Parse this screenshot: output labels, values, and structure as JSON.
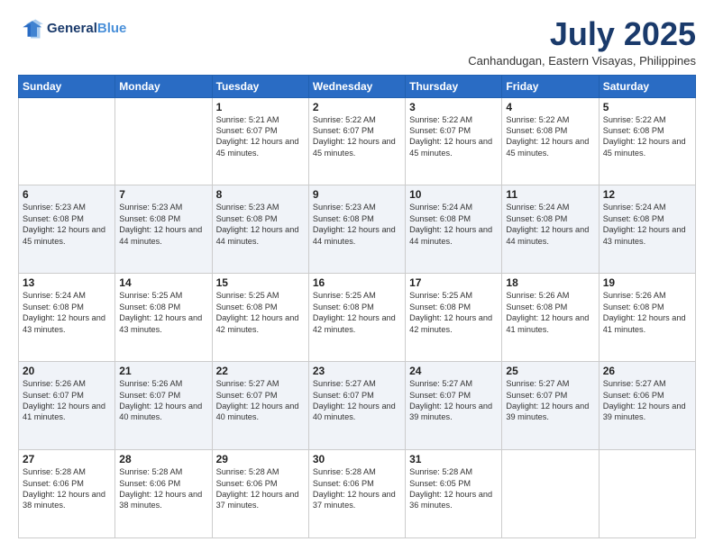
{
  "header": {
    "logo_line1": "General",
    "logo_line2": "Blue",
    "month_title": "July 2025",
    "subtitle": "Canhandugan, Eastern Visayas, Philippines"
  },
  "days_of_week": [
    "Sunday",
    "Monday",
    "Tuesday",
    "Wednesday",
    "Thursday",
    "Friday",
    "Saturday"
  ],
  "weeks": [
    {
      "days": [
        {
          "num": "",
          "info": ""
        },
        {
          "num": "",
          "info": ""
        },
        {
          "num": "1",
          "info": "Sunrise: 5:21 AM\nSunset: 6:07 PM\nDaylight: 12 hours and 45 minutes."
        },
        {
          "num": "2",
          "info": "Sunrise: 5:22 AM\nSunset: 6:07 PM\nDaylight: 12 hours and 45 minutes."
        },
        {
          "num": "3",
          "info": "Sunrise: 5:22 AM\nSunset: 6:07 PM\nDaylight: 12 hours and 45 minutes."
        },
        {
          "num": "4",
          "info": "Sunrise: 5:22 AM\nSunset: 6:08 PM\nDaylight: 12 hours and 45 minutes."
        },
        {
          "num": "5",
          "info": "Sunrise: 5:22 AM\nSunset: 6:08 PM\nDaylight: 12 hours and 45 minutes."
        }
      ]
    },
    {
      "days": [
        {
          "num": "6",
          "info": "Sunrise: 5:23 AM\nSunset: 6:08 PM\nDaylight: 12 hours and 45 minutes."
        },
        {
          "num": "7",
          "info": "Sunrise: 5:23 AM\nSunset: 6:08 PM\nDaylight: 12 hours and 44 minutes."
        },
        {
          "num": "8",
          "info": "Sunrise: 5:23 AM\nSunset: 6:08 PM\nDaylight: 12 hours and 44 minutes."
        },
        {
          "num": "9",
          "info": "Sunrise: 5:23 AM\nSunset: 6:08 PM\nDaylight: 12 hours and 44 minutes."
        },
        {
          "num": "10",
          "info": "Sunrise: 5:24 AM\nSunset: 6:08 PM\nDaylight: 12 hours and 44 minutes."
        },
        {
          "num": "11",
          "info": "Sunrise: 5:24 AM\nSunset: 6:08 PM\nDaylight: 12 hours and 44 minutes."
        },
        {
          "num": "12",
          "info": "Sunrise: 5:24 AM\nSunset: 6:08 PM\nDaylight: 12 hours and 43 minutes."
        }
      ]
    },
    {
      "days": [
        {
          "num": "13",
          "info": "Sunrise: 5:24 AM\nSunset: 6:08 PM\nDaylight: 12 hours and 43 minutes."
        },
        {
          "num": "14",
          "info": "Sunrise: 5:25 AM\nSunset: 6:08 PM\nDaylight: 12 hours and 43 minutes."
        },
        {
          "num": "15",
          "info": "Sunrise: 5:25 AM\nSunset: 6:08 PM\nDaylight: 12 hours and 42 minutes."
        },
        {
          "num": "16",
          "info": "Sunrise: 5:25 AM\nSunset: 6:08 PM\nDaylight: 12 hours and 42 minutes."
        },
        {
          "num": "17",
          "info": "Sunrise: 5:25 AM\nSunset: 6:08 PM\nDaylight: 12 hours and 42 minutes."
        },
        {
          "num": "18",
          "info": "Sunrise: 5:26 AM\nSunset: 6:08 PM\nDaylight: 12 hours and 41 minutes."
        },
        {
          "num": "19",
          "info": "Sunrise: 5:26 AM\nSunset: 6:08 PM\nDaylight: 12 hours and 41 minutes."
        }
      ]
    },
    {
      "days": [
        {
          "num": "20",
          "info": "Sunrise: 5:26 AM\nSunset: 6:07 PM\nDaylight: 12 hours and 41 minutes."
        },
        {
          "num": "21",
          "info": "Sunrise: 5:26 AM\nSunset: 6:07 PM\nDaylight: 12 hours and 40 minutes."
        },
        {
          "num": "22",
          "info": "Sunrise: 5:27 AM\nSunset: 6:07 PM\nDaylight: 12 hours and 40 minutes."
        },
        {
          "num": "23",
          "info": "Sunrise: 5:27 AM\nSunset: 6:07 PM\nDaylight: 12 hours and 40 minutes."
        },
        {
          "num": "24",
          "info": "Sunrise: 5:27 AM\nSunset: 6:07 PM\nDaylight: 12 hours and 39 minutes."
        },
        {
          "num": "25",
          "info": "Sunrise: 5:27 AM\nSunset: 6:07 PM\nDaylight: 12 hours and 39 minutes."
        },
        {
          "num": "26",
          "info": "Sunrise: 5:27 AM\nSunset: 6:06 PM\nDaylight: 12 hours and 39 minutes."
        }
      ]
    },
    {
      "days": [
        {
          "num": "27",
          "info": "Sunrise: 5:28 AM\nSunset: 6:06 PM\nDaylight: 12 hours and 38 minutes."
        },
        {
          "num": "28",
          "info": "Sunrise: 5:28 AM\nSunset: 6:06 PM\nDaylight: 12 hours and 38 minutes."
        },
        {
          "num": "29",
          "info": "Sunrise: 5:28 AM\nSunset: 6:06 PM\nDaylight: 12 hours and 37 minutes."
        },
        {
          "num": "30",
          "info": "Sunrise: 5:28 AM\nSunset: 6:06 PM\nDaylight: 12 hours and 37 minutes."
        },
        {
          "num": "31",
          "info": "Sunrise: 5:28 AM\nSunset: 6:05 PM\nDaylight: 12 hours and 36 minutes."
        },
        {
          "num": "",
          "info": ""
        },
        {
          "num": "",
          "info": ""
        }
      ]
    }
  ]
}
